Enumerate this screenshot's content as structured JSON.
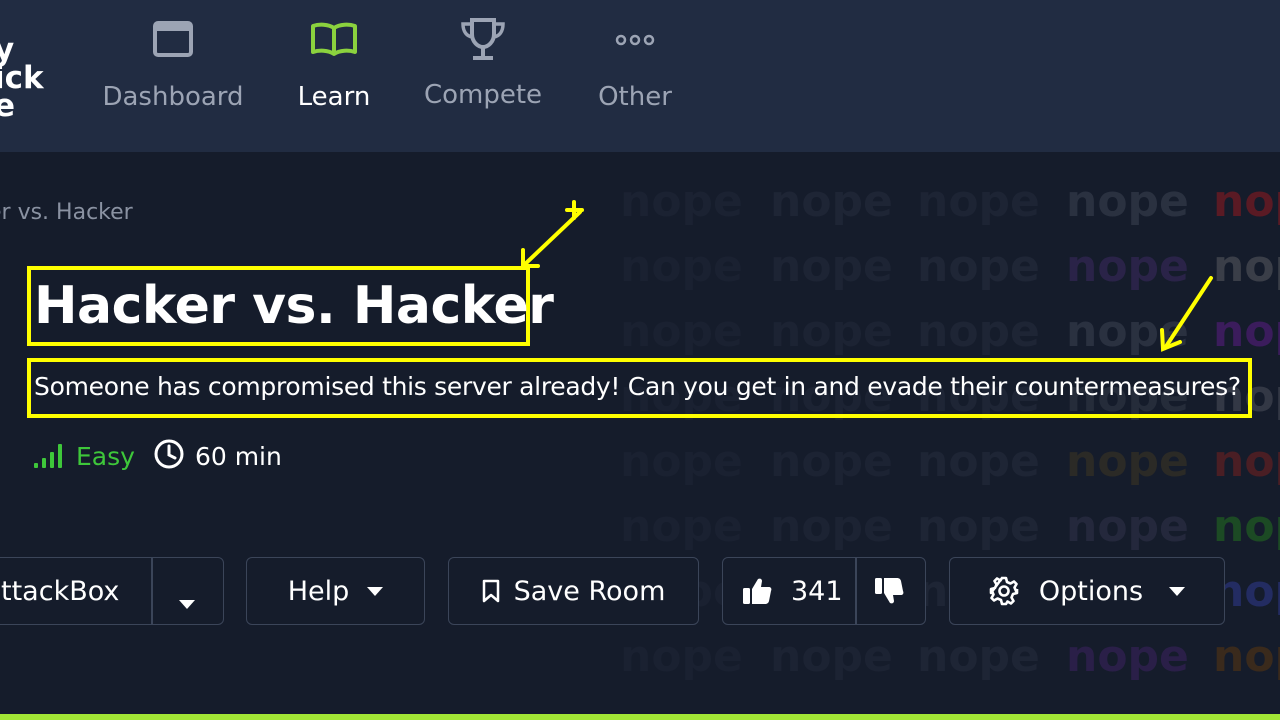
{
  "logo": {
    "lines": [
      "y",
      "ick",
      "e"
    ]
  },
  "nav": {
    "items": [
      {
        "label": "Dashboard",
        "icon": "window-icon"
      },
      {
        "label": "Learn",
        "icon": "book-icon",
        "active": true
      },
      {
        "label": "Compete",
        "icon": "trophy-icon"
      },
      {
        "label": "Other",
        "icon": "more-dots-icon"
      }
    ]
  },
  "breadcrumb": "er vs. Hacker",
  "room": {
    "title": "Hacker vs. Hacker",
    "description": "Someone has compromised this server already! Can you get in and evade their countermeasures?",
    "difficulty": "Easy",
    "duration": "60 min"
  },
  "actions": {
    "attackbox_label": "ttackBox",
    "help_label": "Help",
    "save_label": "Save Room",
    "likes": "341",
    "options_label": "Options"
  },
  "background_word": "nope",
  "colors": {
    "highlight": "#ffff00",
    "easy": "#3ec73a",
    "accent_bar": "#a2e636"
  }
}
